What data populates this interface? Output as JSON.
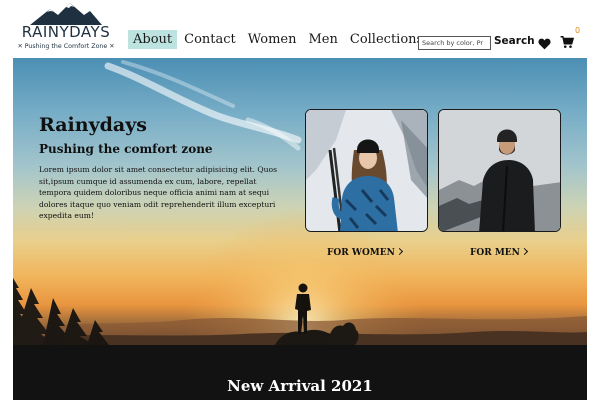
{
  "brand": {
    "name": "RAINYDAYS",
    "tagline": "✕ Pushing the Comfort Zone ✕"
  },
  "nav": {
    "items": [
      {
        "label": "About",
        "active": true
      },
      {
        "label": "Contact",
        "active": false
      },
      {
        "label": "Women",
        "active": false
      },
      {
        "label": "Men",
        "active": false
      },
      {
        "label": "Collections",
        "active": false
      }
    ]
  },
  "search": {
    "placeholder": "Search by color, Pr",
    "button_label": "Search"
  },
  "cart": {
    "count": "0"
  },
  "icons": [
    "heart-icon",
    "cart-icon",
    "mountain-logo-icon",
    "chevron-right-icon"
  ],
  "colors": {
    "nav_active_bg": "#bde3e1",
    "cart_badge": "#e08a1e",
    "band_bg": "#121212"
  },
  "hero": {
    "title": "Rainydays",
    "subtitle": "Pushing the comfort zone",
    "body": "Lorem ipsum dolor sit amet consectetur adipisicing elit. Quos sit,ipsum cumque id assumenda ex cum, labore, repellat tempora quidem doloribus neque officia animi nam at sequi dolores itaque quo veniam odit reprehenderit illum excepturi expedita eum!",
    "women_link": "FOR WOMEN",
    "men_link": "FOR MEN"
  },
  "section": {
    "title": "New Arrival 2021"
  }
}
